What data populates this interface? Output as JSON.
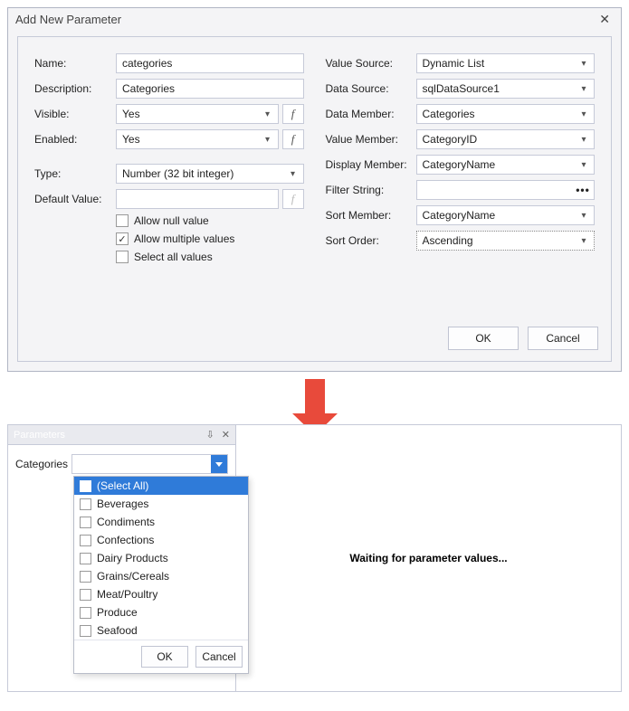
{
  "dialog": {
    "title": "Add New Parameter",
    "left": {
      "name_label": "Name:",
      "name_value": "categories",
      "desc_label": "Description:",
      "desc_value": "Categories",
      "visible_label": "Visible:",
      "visible_value": "Yes",
      "enabled_label": "Enabled:",
      "enabled_value": "Yes",
      "type_label": "Type:",
      "type_value": "Number (32 bit integer)",
      "default_label": "Default Value:",
      "default_value": "",
      "allow_null": "Allow null value",
      "allow_multi": "Allow multiple values",
      "select_all": "Select all values"
    },
    "right": {
      "valsrc_label": "Value Source:",
      "valsrc_value": "Dynamic List",
      "datasrc_label": "Data Source:",
      "datasrc_value": "sqlDataSource1",
      "datamem_label": "Data Member:",
      "datamem_value": "Categories",
      "valmem_label": "Value Member:",
      "valmem_value": "CategoryID",
      "dispmem_label": "Display Member:",
      "dispmem_value": "CategoryName",
      "filter_label": "Filter String:",
      "filter_value": "",
      "sortmem_label": "Sort Member:",
      "sortmem_value": "CategoryName",
      "sortord_label": "Sort Order:",
      "sortord_value": "Ascending"
    },
    "ok": "OK",
    "cancel": "Cancel"
  },
  "panel": {
    "title": "Parameters",
    "field_label": "Categories",
    "dropdown": {
      "select_all": "(Select All)",
      "items": [
        "Beverages",
        "Condiments",
        "Confections",
        "Dairy Products",
        "Grains/Cereals",
        "Meat/Poultry",
        "Produce",
        "Seafood"
      ],
      "ok": "OK",
      "cancel": "Cancel"
    },
    "waiting": "Waiting for parameter values..."
  }
}
